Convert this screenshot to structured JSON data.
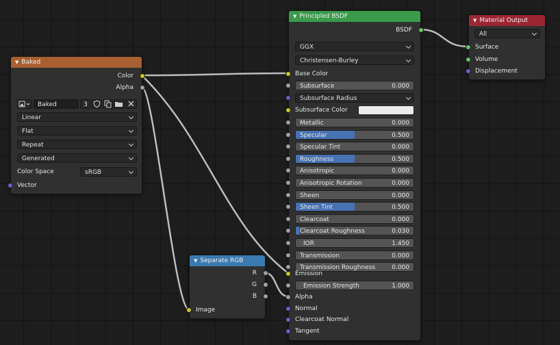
{
  "colors": {
    "baked_header": "#a85f31",
    "bsdf_header": "#3a9b4b",
    "output_header": "#9c2633",
    "separate_header": "#3a7ab0",
    "link": "#bdbdbd"
  },
  "nodes": {
    "baked": {
      "title": "Baked",
      "outputs": [
        "Color",
        "Alpha"
      ],
      "image": {
        "name": "Baked",
        "users": "3"
      },
      "interpolation": "Linear",
      "projection": "Flat",
      "extension": "Repeat",
      "source": "Generated",
      "color_space_label": "Color Space",
      "color_space": "sRGB",
      "vector_label": "Vector"
    },
    "separate": {
      "title": "Separate RGB",
      "outputs": [
        "R",
        "G",
        "B"
      ],
      "input": "Image"
    },
    "bsdf": {
      "title": "Principled BSDF",
      "output": "BSDF",
      "distribution": "GGX",
      "subsurface_method": "Christensen-Burley",
      "base_color": "Base Color",
      "subsurface": {
        "name": "Subsurface",
        "value": "0.000"
      },
      "subsurface_radius": "Subsurface Radius",
      "subsurface_color": "Subsurface Color",
      "sliders": [
        {
          "name": "Metallic",
          "value": "0.000",
          "fill": 0.0
        },
        {
          "name": "Specular",
          "value": "0.500",
          "fill": 0.5
        },
        {
          "name": "Specular Tint",
          "value": "0.000",
          "fill": 0.0
        },
        {
          "name": "Roughness",
          "value": "0.500",
          "fill": 0.5
        },
        {
          "name": "Anisotropic",
          "value": "0.000",
          "fill": 0.0
        },
        {
          "name": "Anisotropic Rotation",
          "value": "0.000",
          "fill": 0.0
        },
        {
          "name": "Sheen",
          "value": "0.000",
          "fill": 0.0
        },
        {
          "name": "Sheen Tint",
          "value": "0.500",
          "fill": 0.5
        },
        {
          "name": "Clearcoat",
          "value": "0.000",
          "fill": 0.0
        },
        {
          "name": "Clearcoat Roughness",
          "value": "0.030",
          "fill": 0.03
        },
        {
          "name": "IOR",
          "value": "1.450",
          "fill": 0.0
        },
        {
          "name": "Transmission",
          "value": "0.000",
          "fill": 0.0
        },
        {
          "name": "Transmission Roughness",
          "value": "0.000",
          "fill": 0.0
        }
      ],
      "emission": "Emission",
      "emission_strength": {
        "name": "Emission Strength",
        "value": "1.000"
      },
      "alpha": "Alpha",
      "normal": "Normal",
      "clearcoat_normal": "Clearcoat Normal",
      "tangent": "Tangent"
    },
    "output": {
      "title": "Material Output",
      "target": "All",
      "inputs": [
        "Surface",
        "Volume",
        "Displacement"
      ]
    }
  }
}
